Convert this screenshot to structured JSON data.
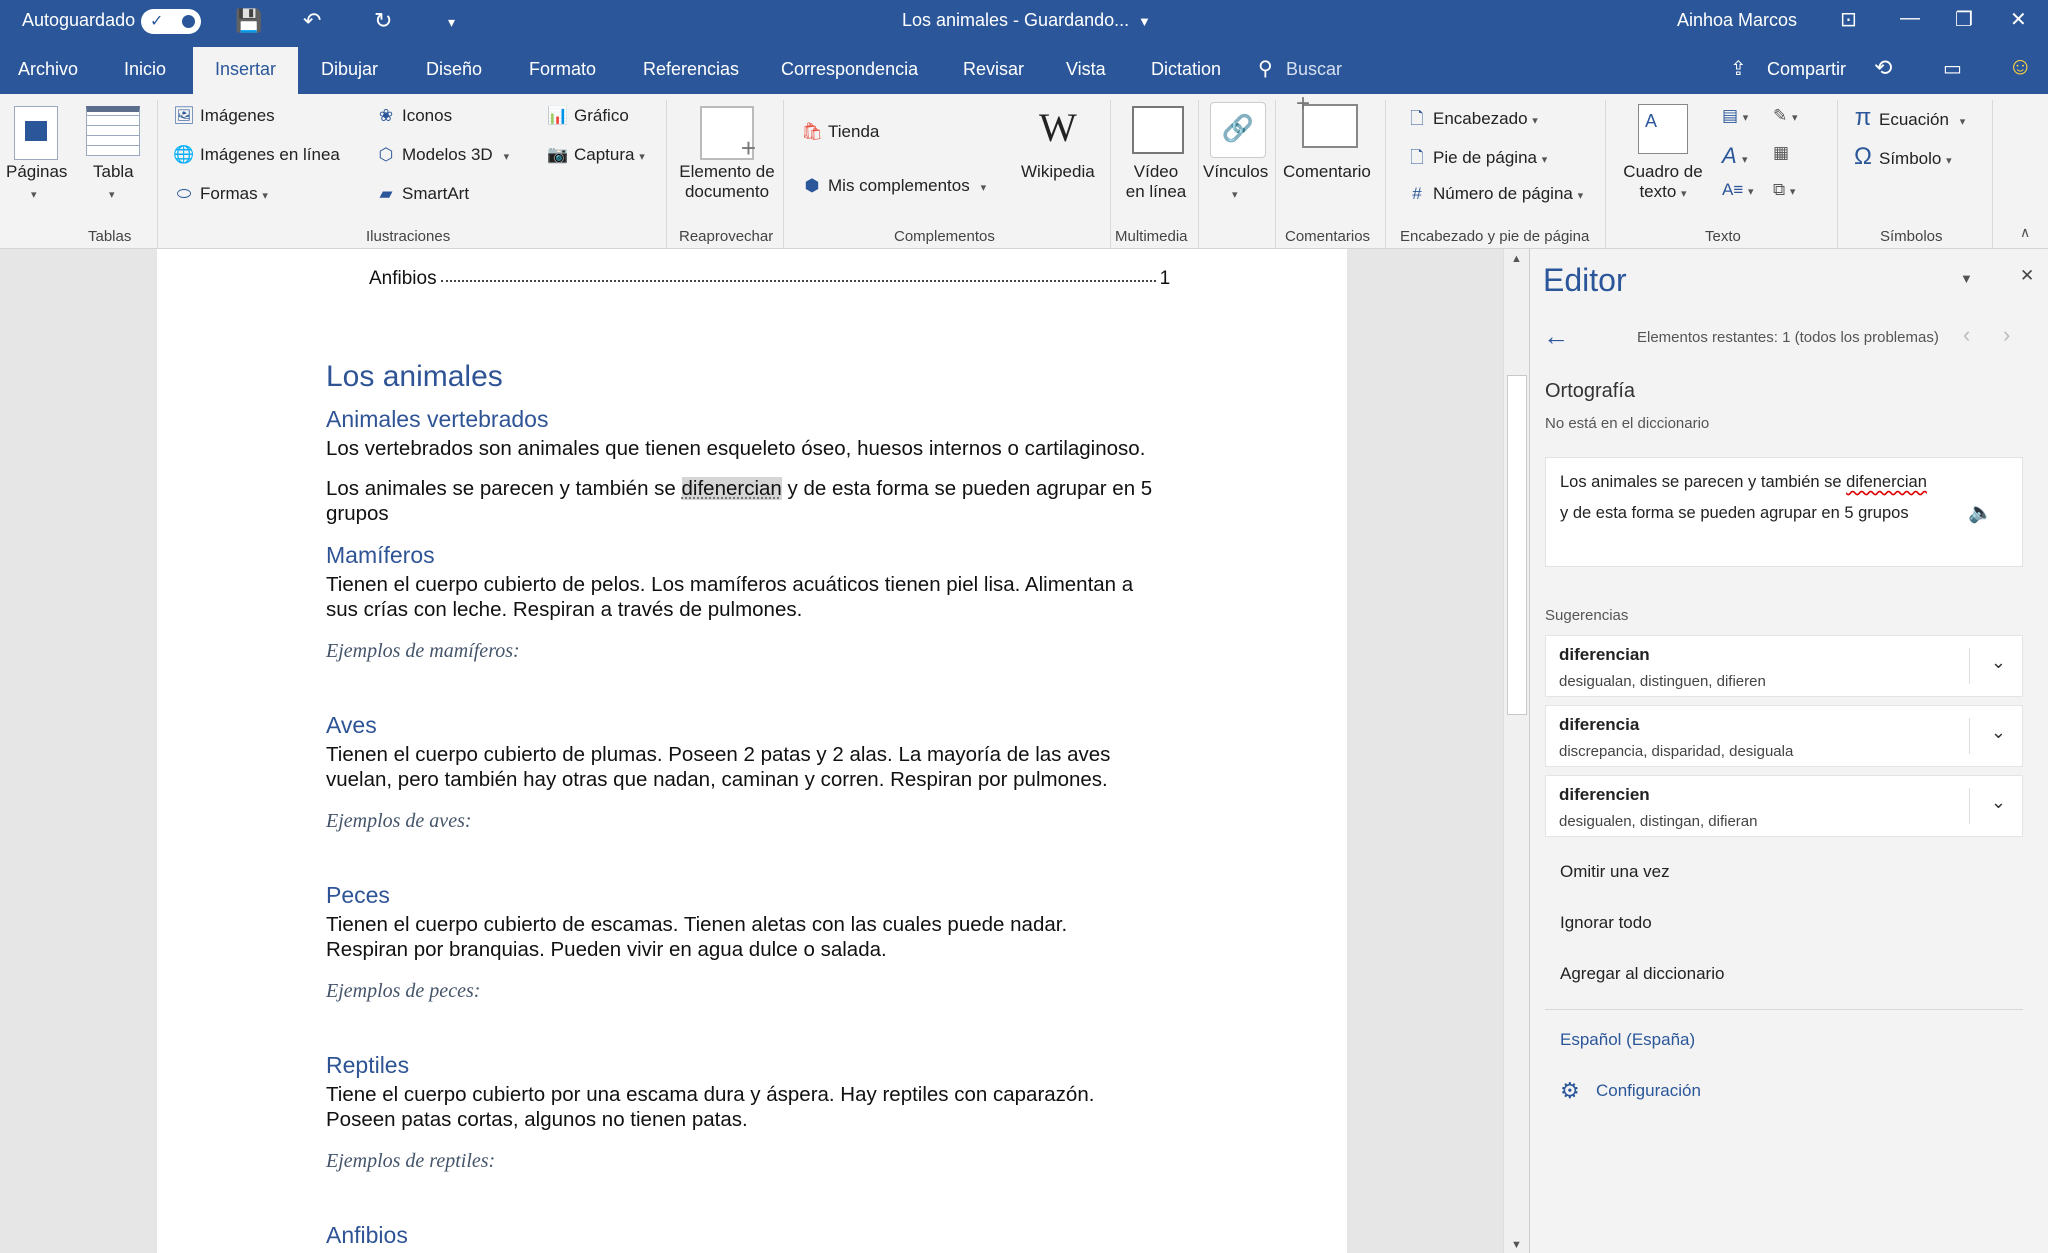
{
  "titlebar": {
    "autosave_label": "Autoguardado",
    "doc_title": "Los animales  -  Guardando...",
    "user": "Ainhoa Marcos"
  },
  "tabs": [
    "Archivo",
    "Inicio",
    "Insertar",
    "Dibujar",
    "Diseño",
    "Formato",
    "Referencias",
    "Correspondencia",
    "Revisar",
    "Vista",
    "Dictation"
  ],
  "active_tab": "Insertar",
  "search_label": "Buscar",
  "share_label": "Compartir",
  "ribbon": {
    "paginas": "Páginas",
    "tabla": "Tabla",
    "imagenes": "Imágenes",
    "imagenes_linea": "Imágenes en línea",
    "formas": "Formas",
    "iconos": "Iconos",
    "modelos3d": "Modelos 3D",
    "smartart": "SmartArt",
    "grafico": "Gráfico",
    "captura": "Captura",
    "elemento_1": "Elemento de",
    "elemento_2": "documento",
    "tienda": "Tienda",
    "mis_complementos": "Mis complementos",
    "wikipedia": "Wikipedia",
    "video_1": "Vídeo",
    "video_2": "en línea",
    "vinculos": "Vínculos",
    "comentario": "Comentario",
    "encabezado": "Encabezado",
    "pie_pagina": "Pie de página",
    "numero_pagina": "Número de página",
    "cuadro_1": "Cuadro de",
    "cuadro_2": "texto",
    "ecuacion": "Ecuación",
    "simbolo": "Símbolo",
    "groups": {
      "tablas": "Tablas",
      "ilustraciones": "Ilustraciones",
      "reaprovechar": "Reaprovechar",
      "complementos": "Complementos",
      "multimedia": "Multimedia",
      "comentarios": "Comentarios",
      "encabezado_pie": "Encabezado y pie de página",
      "texto": "Texto",
      "simbolos": "Símbolos"
    }
  },
  "document": {
    "toc_entry": "Anfibios",
    "toc_page": "1",
    "title": "Los animales",
    "h_vertebrados": "Animales vertebrados",
    "p_vertebrados": "Los vertebrados son animales que tienen esqueleto óseo, huesos internos o cartilaginoso.",
    "p_grupos_a": "Los animales se parecen y también se ",
    "p_grupos_word": "difenercian",
    "p_grupos_b": " y de esta forma se pueden agrupar en 5",
    "p_grupos_c": "grupos",
    "h_mamiferos": "Mamíferos",
    "p_mamiferos_1": "Tienen el cuerpo cubierto de pelos. Los mamíferos acuáticos tienen piel lisa. Alimentan a",
    "p_mamiferos_2": "sus crías con leche. Respiran a través de pulmones.",
    "ex_mamiferos": "Ejemplos de mamíferos:",
    "h_aves": "Aves",
    "p_aves_1": "Tienen el cuerpo cubierto de plumas. Poseen 2 patas y 2 alas. La mayoría de las aves",
    "p_aves_2": "vuelan, pero también hay otras que nadan, caminan y corren. Respiran por pulmones.",
    "ex_aves": "Ejemplos de aves:",
    "h_peces": "Peces",
    "p_peces_1": "Tienen el cuerpo cubierto de escamas. Tienen aletas con las cuales puede nadar.",
    "p_peces_2": "Respiran por branquias. Pueden vivir en agua dulce o salada.",
    "ex_peces": "Ejemplos de peces:",
    "h_reptiles": "Reptiles",
    "p_reptiles_1": "Tiene el cuerpo cubierto por una escama dura y áspera. Hay reptiles con caparazón.",
    "p_reptiles_2": "Poseen patas cortas, algunos no tienen patas.",
    "ex_reptiles": "Ejemplos de reptiles:",
    "h_anfibios": "Anfibios"
  },
  "editor": {
    "title": "Editor",
    "remaining": "Elementos restantes: 1 (todos los problemas)",
    "section": "Ortografía",
    "subtitle": "No está en el diccionario",
    "context_1a": "Los animales se parecen y también se ",
    "context_word": "difenercian",
    "context_2": "y de esta forma se pueden agrupar en 5 grupos",
    "suggestions_label": "Sugerencias",
    "suggestions": [
      {
        "word": "diferencian",
        "synonyms": "desigualan, distinguen, difieren"
      },
      {
        "word": "diferencia",
        "synonyms": "discrepancia, disparidad, desiguala"
      },
      {
        "word": "diferencien",
        "synonyms": "desigualen, distingan, difieran"
      }
    ],
    "omit_once": "Omitir una vez",
    "ignore_all": "Ignorar todo",
    "add_dictionary": "Agregar al diccionario",
    "language": "Español (España)",
    "settings": "Configuración"
  },
  "colors": {
    "brand": "#2b579a",
    "heading": "#2f5496",
    "link": "#2b579a"
  }
}
